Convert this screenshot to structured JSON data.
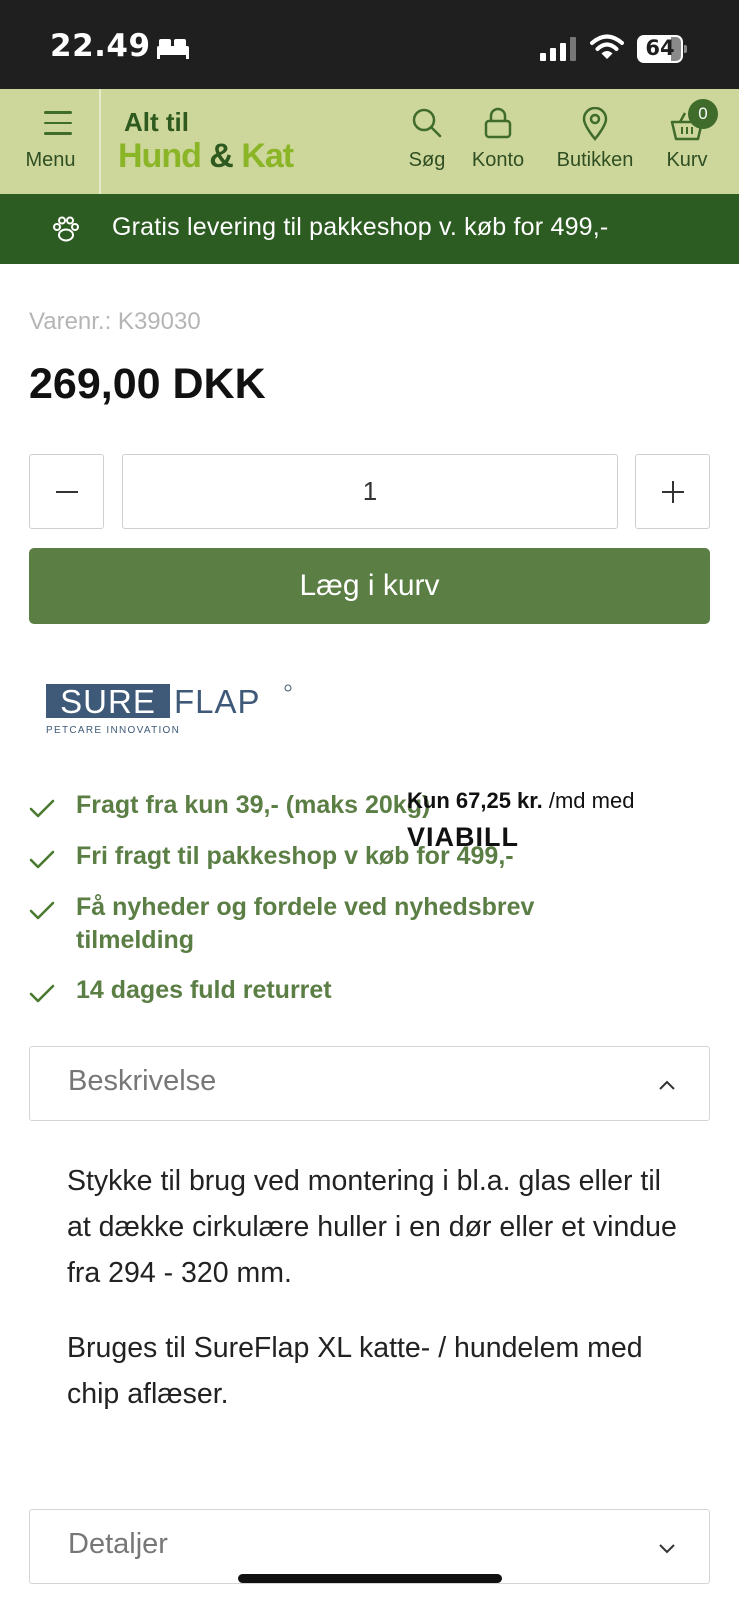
{
  "status_bar": {
    "time": "22.49",
    "battery": "64"
  },
  "header": {
    "menu_label": "Menu",
    "logo_line1": "Alt til",
    "logo_part_a": "Hund",
    "logo_amp": " & ",
    "logo_part_b": "Kat",
    "nav": [
      {
        "label": "Søg",
        "icon": "search-icon"
      },
      {
        "label": "Konto",
        "icon": "lock-icon"
      },
      {
        "label": "Butikken",
        "icon": "location-pin-icon"
      },
      {
        "label": "Kurv",
        "icon": "basket-icon"
      }
    ],
    "cart_count": "0"
  },
  "promo": {
    "text": "Gratis levering til pakkeshop v. køb for 499,-"
  },
  "product": {
    "sku": "Varenr.: K39030",
    "price": "269,00 DKK",
    "quantity": "1",
    "add_to_cart": "Læg i kurv",
    "brand_name_a": "SURE",
    "brand_name_b": "FLAP",
    "brand_tagline": "PETCARE INNOVATION"
  },
  "benefits": [
    "Fragt fra kun 39,- (maks 20kg)",
    "Fri fragt til pakkeshop v køb for 499,-",
    "Få nyheder og fordele ved nyhedsbrev tilmelding",
    "14 dages fuld returret"
  ],
  "viabill": {
    "amount": "Kun 67,25 kr.",
    "suffix": " /md med",
    "logo": "VIABILL"
  },
  "accordion": {
    "description_title": "Beskrivelse",
    "description_paragraphs": [
      "Stykke til brug ved montering i bl.a. glas eller til at dække cirkulære huller i en dør eller et vindue fra 294 - 320 mm.",
      "Bruges til SureFlap XL katte- / hundelem med chip aflæser."
    ],
    "details_title": "Detaljer"
  },
  "colors": {
    "header_bg": "#cdd79b",
    "banner_bg": "#2d5c23",
    "button_bg": "#5b7e45",
    "benefit_text": "#5b7e45"
  }
}
